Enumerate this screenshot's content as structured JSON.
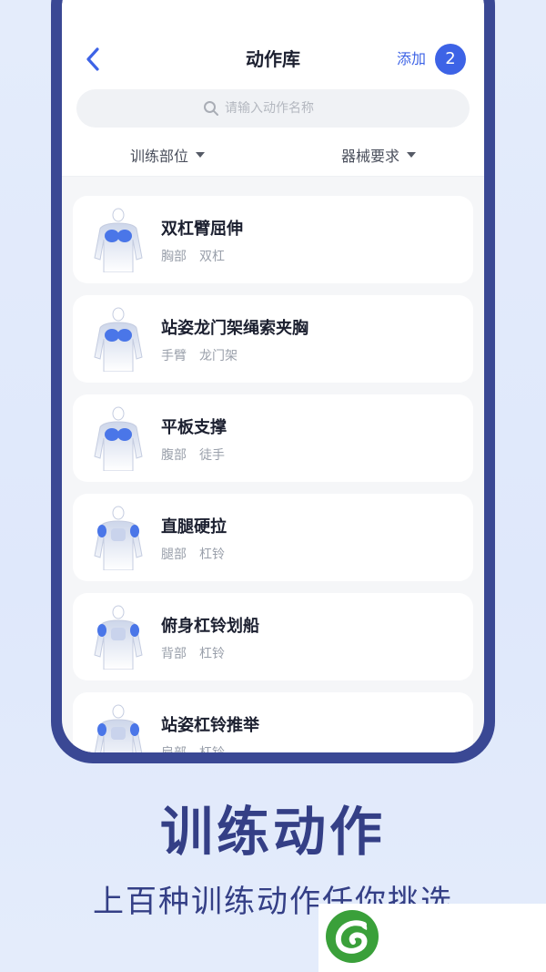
{
  "header": {
    "title": "动作库",
    "add_label": "添加",
    "selected_count": "2"
  },
  "search": {
    "placeholder": "请输入动作名称",
    "value": ""
  },
  "filters": [
    {
      "label": "训练部位"
    },
    {
      "label": "器械要求"
    }
  ],
  "exercises": [
    {
      "name": "双杠臂屈伸",
      "body_part": "胸部",
      "equipment": "双杠",
      "highlight": "chest"
    },
    {
      "name": "站姿龙门架绳索夹胸",
      "body_part": "手臂",
      "equipment": "龙门架",
      "highlight": "chest"
    },
    {
      "name": "平板支撑",
      "body_part": "腹部",
      "equipment": "徒手",
      "highlight": "chest"
    },
    {
      "name": "直腿硬拉",
      "body_part": "腿部",
      "equipment": "杠铃",
      "highlight": "shoulders"
    },
    {
      "name": "俯身杠铃划船",
      "body_part": "背部",
      "equipment": "杠铃",
      "highlight": "shoulders"
    },
    {
      "name": "站姿杠铃推举",
      "body_part": "肩部",
      "equipment": "杠铃",
      "highlight": "shoulders"
    }
  ],
  "promo": {
    "headline": "训练动作",
    "subline": "上百种训练动作任你挑选"
  },
  "colors": {
    "accent": "#3d63e6",
    "frame": "#3a4894",
    "headline": "#343f86",
    "logo_green": "#3aa03a"
  },
  "icons": [
    "back-chevron-icon",
    "search-icon",
    "dropdown-caret-icon",
    "body-thumbnail-icon",
    "app-logo-icon"
  ]
}
